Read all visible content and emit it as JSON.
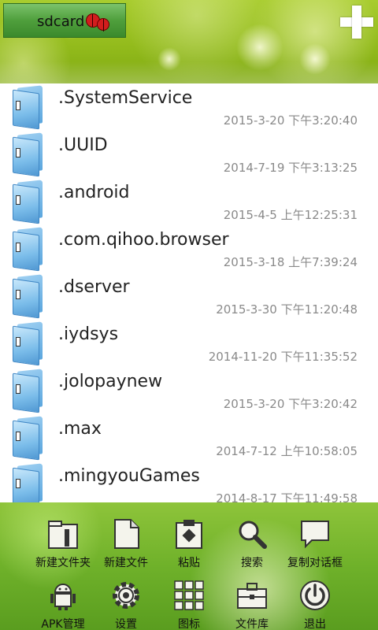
{
  "header": {
    "location_label": "sdcard"
  },
  "files": [
    {
      "name": ".SystemService",
      "date": "2015-3-20 下午3:20:40"
    },
    {
      "name": ".UUID",
      "date": "2014-7-19 下午3:13:25"
    },
    {
      "name": ".android",
      "date": "2015-4-5 上午12:25:31"
    },
    {
      "name": ".com.qihoo.browser",
      "date": "2015-3-18 上午7:39:24"
    },
    {
      "name": ".dserver",
      "date": "2015-3-30 下午11:20:48"
    },
    {
      "name": ".iydsys",
      "date": "2014-11-20 下午11:35:52"
    },
    {
      "name": ".jolopaynew",
      "date": "2015-3-20 下午3:20:42"
    },
    {
      "name": ".max",
      "date": "2014-7-12 上午10:58:05"
    },
    {
      "name": ".mingyouGames",
      "date": "2014-8-17 下午11:49:58"
    }
  ],
  "toolbar": {
    "items": [
      {
        "label": "新建文件夹",
        "icon": "new-folder-icon"
      },
      {
        "label": "新建文件",
        "icon": "new-file-icon"
      },
      {
        "label": "粘贴",
        "icon": "paste-icon"
      },
      {
        "label": "搜索",
        "icon": "search-icon"
      },
      {
        "label": "复制对话框",
        "icon": "copy-dialog-icon"
      },
      {
        "label": "APK管理",
        "icon": "android-icon"
      },
      {
        "label": "设置",
        "icon": "gear-icon"
      },
      {
        "label": "图标",
        "icon": "grid-icon"
      },
      {
        "label": "文件库",
        "icon": "toolbox-icon"
      },
      {
        "label": "退出",
        "icon": "power-icon"
      }
    ]
  },
  "colors": {
    "header_green": "#93bb1c",
    "toolbar_green": "#6fb12a",
    "date_gray": "#8a8a8a",
    "folder_blue": "#7bbdea"
  }
}
